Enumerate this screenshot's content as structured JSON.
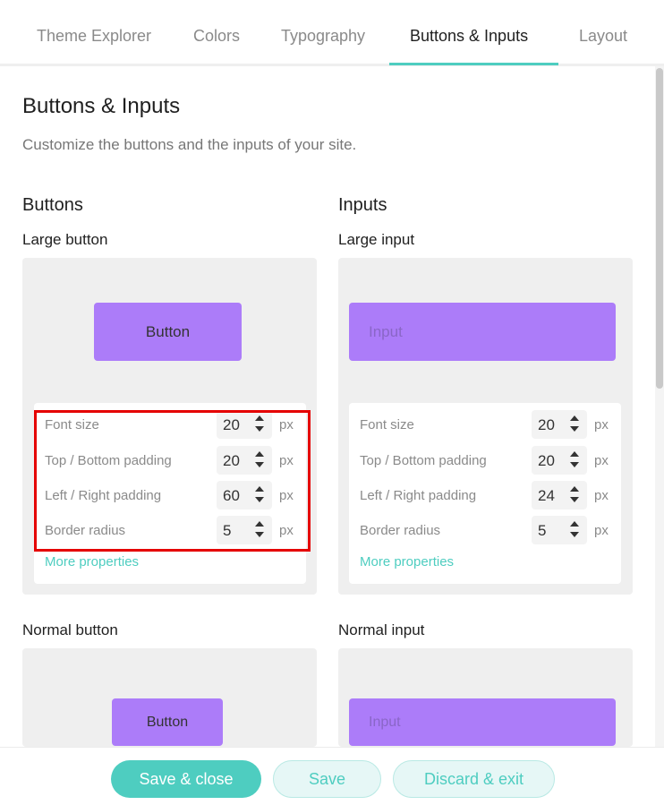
{
  "tabs": [
    {
      "label": "Theme Explorer",
      "active": false
    },
    {
      "label": "Colors",
      "active": false
    },
    {
      "label": "Typography",
      "active": false
    },
    {
      "label": "Buttons & Inputs",
      "active": true
    },
    {
      "label": "Layout",
      "active": false
    }
  ],
  "page": {
    "title": "Buttons & Inputs",
    "subtitle": "Customize the buttons and the inputs of your site."
  },
  "buttons": {
    "heading": "Buttons",
    "large": {
      "title": "Large button",
      "preview_label": "Button",
      "properties": [
        {
          "label": "Font size",
          "value": "20",
          "unit": "px"
        },
        {
          "label": "Top / Bottom padding",
          "value": "20",
          "unit": "px"
        },
        {
          "label": "Left / Right padding",
          "value": "60",
          "unit": "px"
        },
        {
          "label": "Border radius",
          "value": "5",
          "unit": "px"
        }
      ],
      "more_link": "More properties"
    },
    "normal": {
      "title": "Normal button",
      "preview_label": "Button"
    }
  },
  "inputs": {
    "heading": "Inputs",
    "large": {
      "title": "Large input",
      "preview_placeholder": "Input",
      "properties": [
        {
          "label": "Font size",
          "value": "20",
          "unit": "px"
        },
        {
          "label": "Top / Bottom padding",
          "value": "20",
          "unit": "px"
        },
        {
          "label": "Left / Right padding",
          "value": "24",
          "unit": "px"
        },
        {
          "label": "Border radius",
          "value": "5",
          "unit": "px"
        }
      ],
      "more_link": "More properties"
    },
    "normal": {
      "title": "Normal input",
      "preview_placeholder": "Input"
    }
  },
  "footer": {
    "save_close": "Save & close",
    "save": "Save",
    "discard_exit": "Discard & exit"
  },
  "colors": {
    "accent": "#4ecdc0",
    "preview_purple": "#ac7cf9",
    "highlight_red": "#e50000"
  }
}
